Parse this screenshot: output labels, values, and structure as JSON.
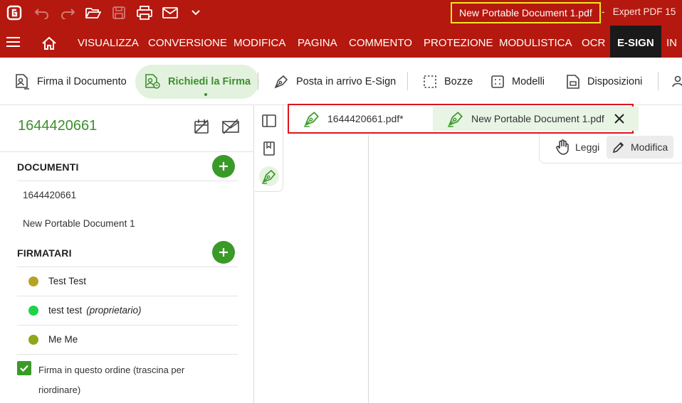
{
  "titlebar": {
    "document_title": "New Portable Document 1.pdf",
    "separator": "-",
    "app_name": "Expert PDF 15"
  },
  "ribbon": {
    "tabs": [
      "VISUALIZZA",
      "CONVERSIONE",
      "MODIFICA",
      "PAGINA",
      "COMMENTO",
      "PROTEZIONE",
      "MODULISTICA",
      "OCR",
      "E-SIGN",
      "IN"
    ],
    "active_tab": "E-SIGN"
  },
  "toolbar": {
    "sign_document": "Firma il Documento",
    "request_signature": "Richiedi la Firma",
    "esign_inbox": "Posta in arrivo E-Sign",
    "drafts": "Bozze",
    "templates": "Modelli",
    "dispositions": "Disposizioni"
  },
  "left_panel": {
    "title": "1644420661",
    "documents_header": "DOCUMENTI",
    "documents": [
      "1644420661",
      "New Portable Document 1"
    ],
    "signers_header": "FIRMATARI",
    "signers": [
      {
        "name": "Test Test",
        "role": "",
        "color": "#b4a426"
      },
      {
        "name": "test test",
        "role": "(proprietario)",
        "color": "#1fd24a"
      },
      {
        "name": "Me Me",
        "role": "",
        "color": "#92a51c"
      }
    ],
    "order_checkbox_label": "Firma in questo ordine (trascina per riordinare)"
  },
  "doc_tabs": [
    {
      "label": "1644420661.pdf*",
      "active": false
    },
    {
      "label": "New Portable Document 1.pdf",
      "active": true
    }
  ],
  "mode_toggle": {
    "read": "Leggi",
    "modify": "Modifica",
    "active": "Modifica"
  },
  "colors": {
    "brand_red": "#b5180e",
    "accent_green": "#3a9a27",
    "highlight_yellow": "#f7e81f",
    "highlight_red": "#e0141e"
  }
}
